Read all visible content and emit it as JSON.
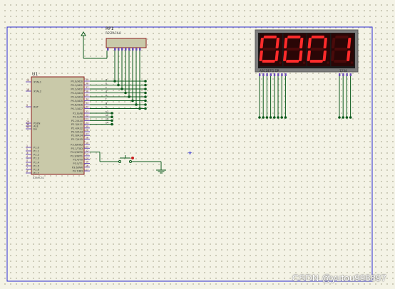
{
  "workspace": {
    "grid": "dotted",
    "colors": {
      "background": "#f4f3e6",
      "sheet_border": "#2b2bd1",
      "wire": "#0b5a1c",
      "component_body": "#c9c9a9",
      "component_outline": "#8a1c1c",
      "display_frame": "#7d7d7d",
      "display_face": "#1a1a1a",
      "segment_on": "#ff2b2b",
      "segment_off": "#4a0a0a",
      "junction": "#0b5a1c"
    }
  },
  "resistor_pack": {
    "ref": "RP1",
    "part": "RESPACK-8"
  },
  "microcontroller": {
    "ref": "U1",
    "part": "AT89C51",
    "left_pins": [
      {
        "num": "19",
        "name": "XTAL1"
      },
      {
        "num": "18",
        "name": "XTAL2"
      },
      {
        "num": "9",
        "name": "RST"
      },
      {
        "num": "29",
        "name": "PSEN"
      },
      {
        "num": "30",
        "name": "ALE"
      },
      {
        "num": "31",
        "name": "EA"
      },
      {
        "num": "1",
        "name": "P1.0"
      },
      {
        "num": "2",
        "name": "P1.1"
      },
      {
        "num": "3",
        "name": "P1.2"
      },
      {
        "num": "4",
        "name": "P1.3"
      },
      {
        "num": "5",
        "name": "P1.4"
      },
      {
        "num": "6",
        "name": "P1.5"
      },
      {
        "num": "7",
        "name": "P1.6"
      },
      {
        "num": "8",
        "name": "P1.7"
      }
    ],
    "right_pins": [
      {
        "num": "39",
        "name": "P0.0/AD0"
      },
      {
        "num": "38",
        "name": "P0.1/AD1"
      },
      {
        "num": "37",
        "name": "P0.2/AD2"
      },
      {
        "num": "36",
        "name": "P0.3/AD3"
      },
      {
        "num": "35",
        "name": "P0.4/AD4"
      },
      {
        "num": "34",
        "name": "P0.5/AD5"
      },
      {
        "num": "33",
        "name": "P0.6/AD6"
      },
      {
        "num": "32",
        "name": "P0.7/AD7"
      },
      {
        "num": "21",
        "name": "P2.0/A8"
      },
      {
        "num": "22",
        "name": "P2.1/A9"
      },
      {
        "num": "23",
        "name": "P2.2/A10"
      },
      {
        "num": "24",
        "name": "P2.3/A11"
      },
      {
        "num": "25",
        "name": "P2.4/A12"
      },
      {
        "num": "26",
        "name": "P2.5/A13"
      },
      {
        "num": "27",
        "name": "P2.6/A14"
      },
      {
        "num": "28",
        "name": "P2.7/A15"
      },
      {
        "num": "10",
        "name": "P3.0/RXD"
      },
      {
        "num": "11",
        "name": "P3.1/TXD"
      },
      {
        "num": "12",
        "name": "P3.2/INT0"
      },
      {
        "num": "13",
        "name": "P3.3/INT1"
      },
      {
        "num": "14",
        "name": "P3.4/T0"
      },
      {
        "num": "15",
        "name": "P3.5/T1"
      },
      {
        "num": "16",
        "name": "P3.6/WR"
      },
      {
        "num": "17",
        "name": "P3.7/RD"
      }
    ],
    "p0_net_labels": [
      "a",
      "b",
      "c",
      "d",
      "e",
      "f",
      "g",
      "h"
    ],
    "p2_net_labels": [
      "s1",
      "s2",
      "s3",
      "s4"
    ]
  },
  "display": {
    "digits": [
      "0",
      "0",
      "0",
      "1"
    ],
    "segment_label": "ABCDEFG DP",
    "digit_label": "1234"
  },
  "watermark": "CSDN @yutou998897"
}
